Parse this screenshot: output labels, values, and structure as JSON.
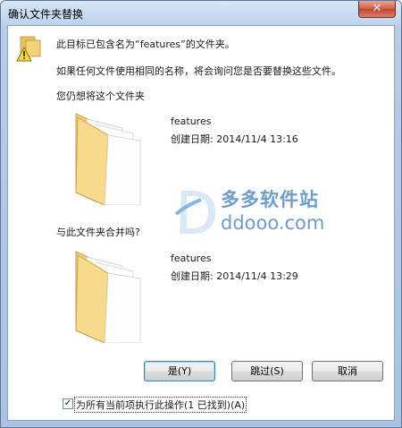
{
  "window": {
    "title": "确认文件夹替换",
    "close_glyph": "✕"
  },
  "message": {
    "line1": "此目标已包含名为“features”的文件夹。",
    "line2": "如果任何文件使用相同的名称，将会询问您是否要替换这些文件。",
    "line3": "您仍想将这个文件夹"
  },
  "target_folder": {
    "name": "features",
    "created": "创建日期: 2014/11/4 13:16"
  },
  "merge_question": "与此文件夹合并吗?",
  "source_folder": {
    "name": "features",
    "created": "创建日期: 2014/11/4 13:29"
  },
  "watermark": {
    "cn": "多多软件站",
    "en": "ddooo.com"
  },
  "buttons": {
    "yes": "是(Y)",
    "skip": "跳过(S)",
    "cancel": "取消"
  },
  "apply_all": {
    "checked": true,
    "glyph": "✓",
    "label": "为所有当前项执行此操作(1 已找到)(A)"
  },
  "colors": {
    "folder": "#f3d27a",
    "watermark": "#6e9dd0"
  }
}
